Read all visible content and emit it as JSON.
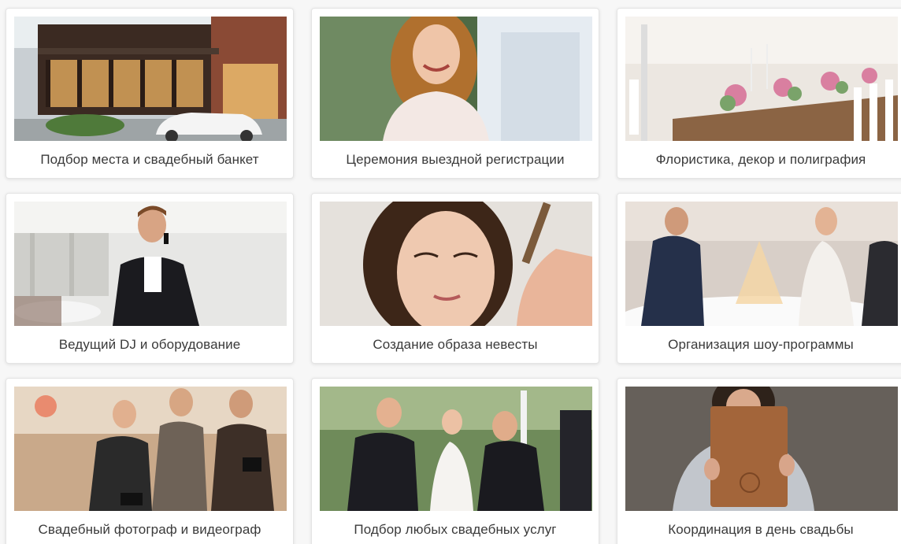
{
  "services": [
    {
      "label": "Подбор места и свадебный банкет",
      "image": "venue-building-photo"
    },
    {
      "label": "Церемония выездной регистрации",
      "image": "smiling-bride-photo"
    },
    {
      "label": "Флористика, декор и полиграфия",
      "image": "decorated-banquet-table-photo"
    },
    {
      "label": "Ведущий DJ и оборудование",
      "image": "host-with-microphone-photo"
    },
    {
      "label": "Создание образа невесты",
      "image": "bride-makeup-photo"
    },
    {
      "label": "Организация шоу-программы",
      "image": "champagne-pyramid-photo"
    },
    {
      "label": "Свадебный фотограф и видеограф",
      "image": "photographers-group-photo"
    },
    {
      "label": "Подбор любых свадебных услуг",
      "image": "couple-celebrating-photo"
    },
    {
      "label": "Координация в день свадьбы",
      "image": "woman-with-folder-photo"
    }
  ]
}
